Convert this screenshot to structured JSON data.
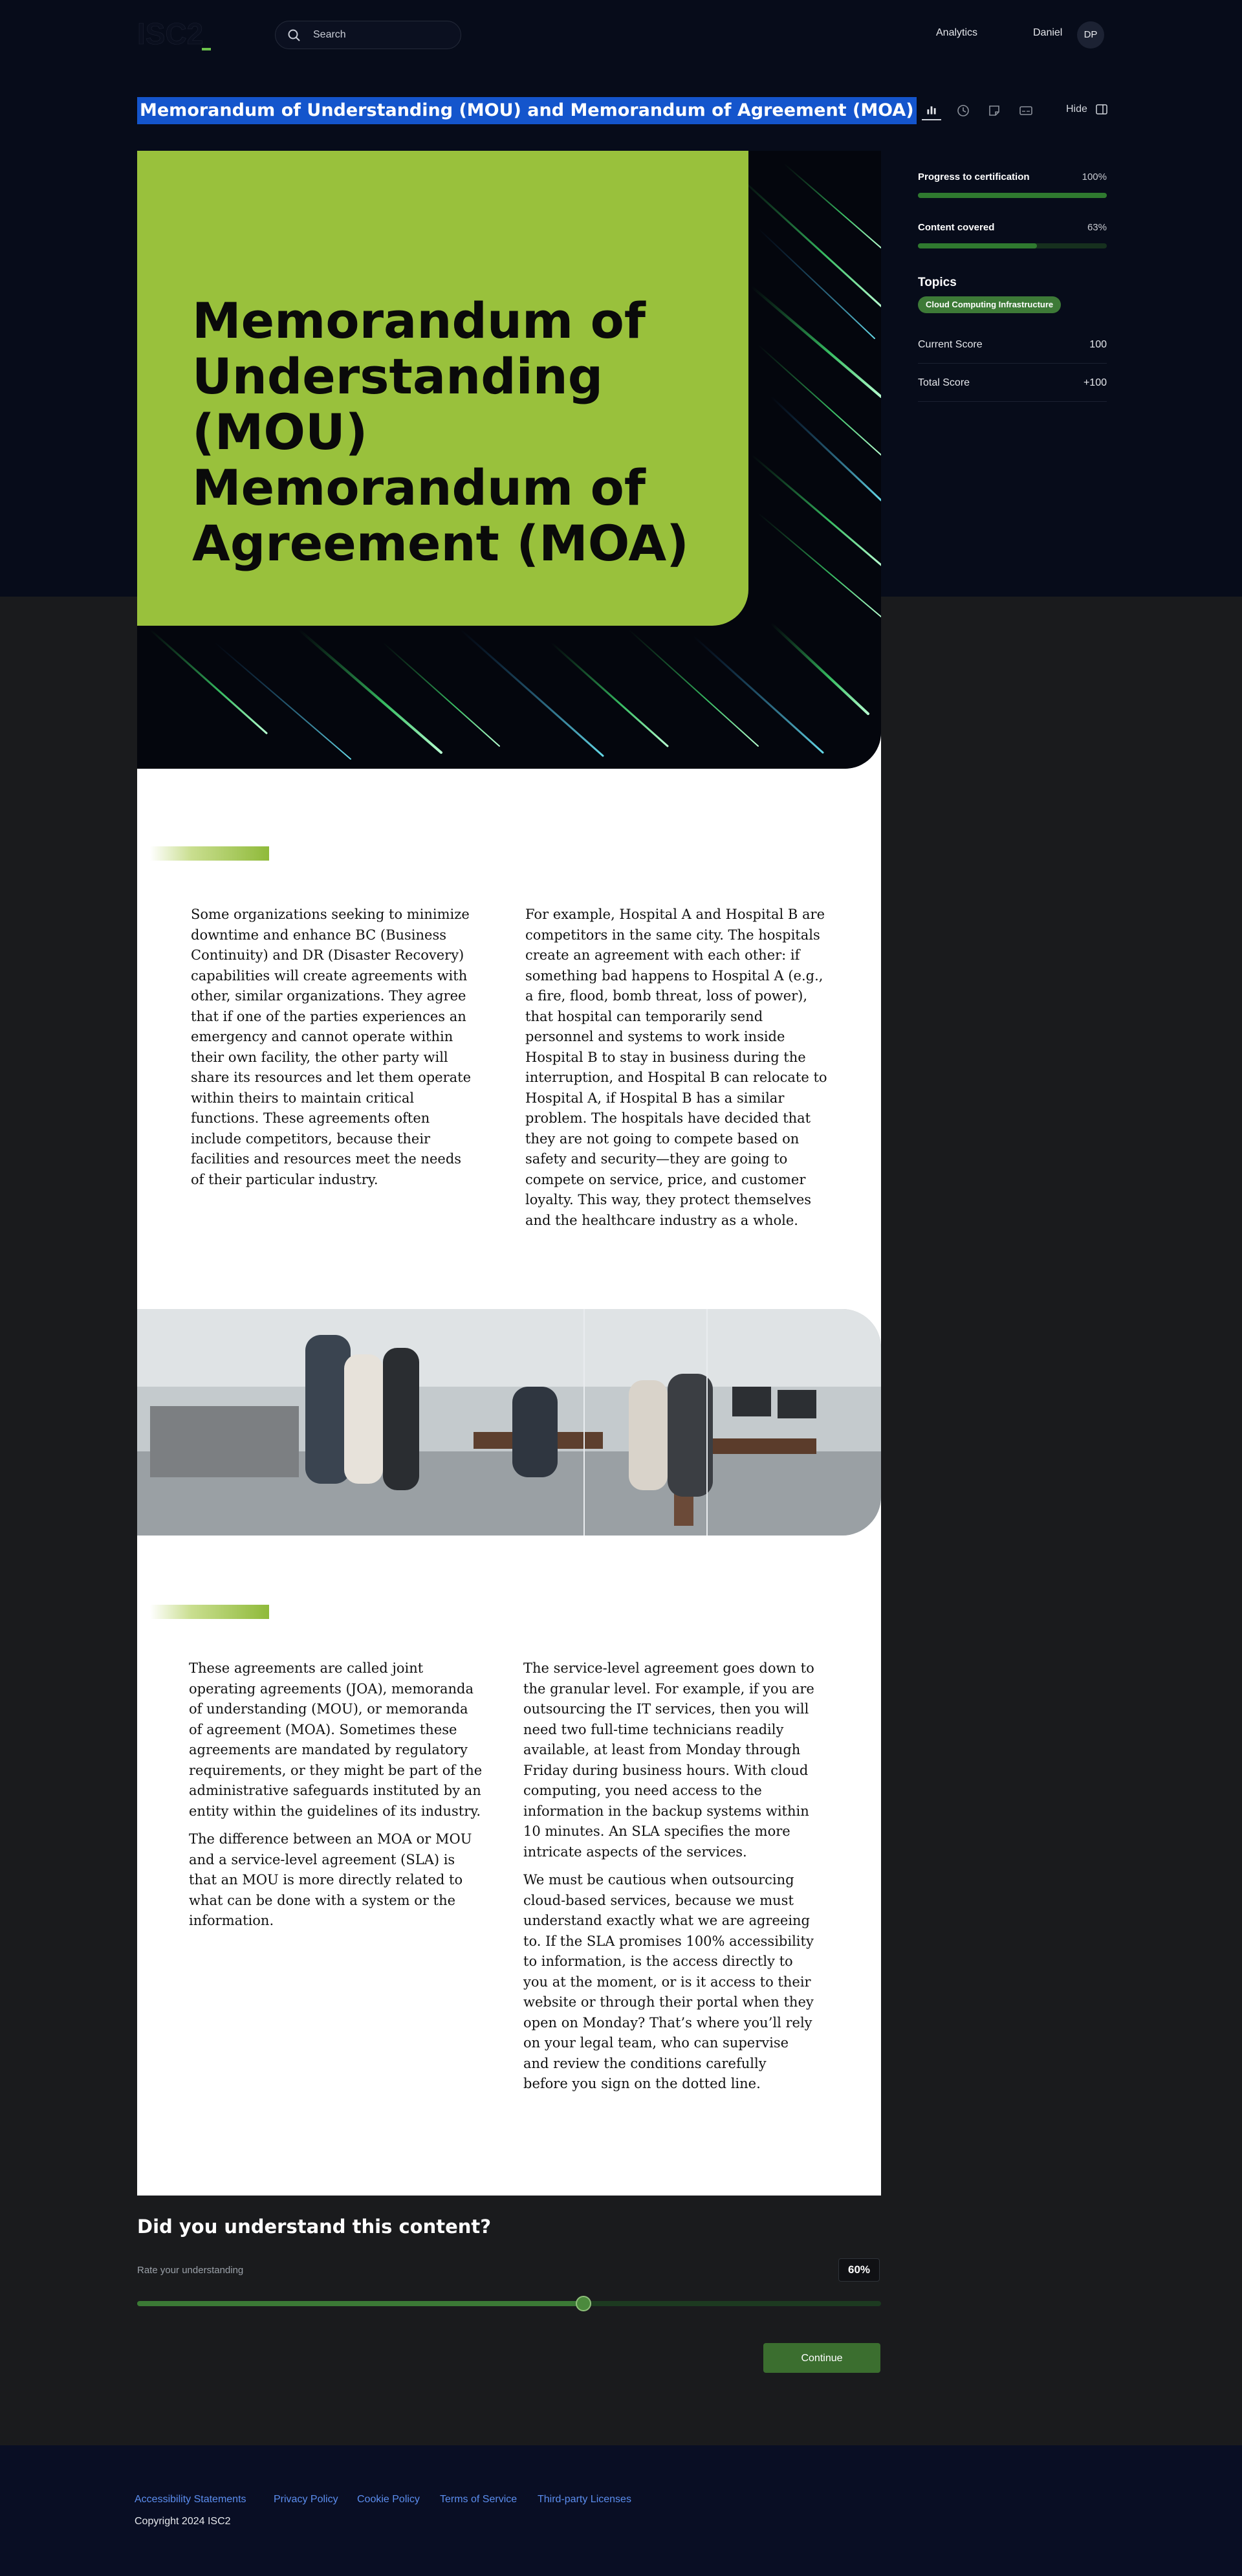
{
  "header": {
    "logo_text": "ISC2",
    "search_placeholder": "Search",
    "nav_analytics": "Analytics",
    "user_name": "Daniel",
    "avatar_initials": "DP"
  },
  "page": {
    "title": "Memorandum of Understanding (MOU) and Memorandum of Agreement (MOA)"
  },
  "toolbar": {
    "icons": [
      "stats-icon",
      "history-icon",
      "note-icon",
      "captions-icon"
    ],
    "hide_label": "Hide"
  },
  "progress": {
    "certification_label": "Progress to certification",
    "certification_value": "100%",
    "certification_fraction": 1.0,
    "content_label": "Content covered",
    "content_value": "63%",
    "content_fraction": 0.63
  },
  "topics": {
    "heading": "Topics",
    "items": [
      "Cloud Computing Infrastructure"
    ]
  },
  "scores": {
    "current_label": "Current Score",
    "current_value": "100",
    "total_label": "Total Score",
    "total_value": "+100"
  },
  "hero": {
    "title": "Memorandum of Understanding (MOU) Memorandum of Agreement (MOA)"
  },
  "section1": {
    "left": "Some organizations seeking to minimize downtime and enhance BC (Business Continuity) and DR (Disaster Recovery) capabilities will create agreements with other, similar organizations. They agree that if one of the parties experiences an emergency and cannot operate within their own facility, the other party will share its resources and let them operate within theirs to maintain critical functions. These agreements often include competitors, because their facilities and resources meet the needs of their particular industry.",
    "right": "For example, Hospital A and Hospital B are competitors in the same city. The hospitals create an agreement with each other: if something bad happens to Hospital A (e.g., a fire, flood, bomb threat, loss of power), that hospital can temporarily send personnel and systems to work inside Hospital B to stay in business during the interruption, and Hospital B can relocate to Hospital A, if Hospital B has a similar problem. The hospitals have decided that they are not going to compete based on safety and security—they are going to compete on service, price, and customer loyalty. This way, they protect themselves and the healthcare industry as a whole."
  },
  "section2": {
    "left_p1": "These agreements are called joint operating agreements (JOA), memoranda of understanding (MOU), or memoranda of agreement (MOA). Sometimes these agreements are mandated by regulatory requirements, or they might be part of the administrative safeguards instituted by an entity within the guidelines of its industry.",
    "left_p2": "The difference between an MOA or MOU and a service-level agreement (SLA) is that an MOU is more directly related to what can be done with a system or the information.",
    "right_p1": "The service-level agreement goes down to the granular level. For example, if you are outsourcing the IT services, then you will need two full-time technicians readily available, at least from Monday through Friday during business hours. With cloud computing, you need access to the information in the backup systems within 10 minutes. An SLA specifies the more intricate aspects of the services.",
    "right_p2": "We must be cautious when outsourcing cloud-based services, because we must understand exactly what we are agreeing to. If the SLA promises 100% accessibility to information, is the access directly to you at the moment, or is it access to their website or through their portal when they open on Monday? That’s where you’ll rely on your legal team, who can supervise and review the conditions carefully before you sign on the dotted line."
  },
  "understanding": {
    "heading": "Did you understand this content?",
    "subheading": "Rate your understanding",
    "value_label": "60%",
    "value_fraction": 0.6,
    "continue_label": "Continue"
  },
  "footer": {
    "links": [
      "Accessibility Statements",
      "Privacy Policy",
      "Cookie Policy",
      "Terms of Service",
      "Third-party Licenses"
    ],
    "copyright": "Copyright 2024 ISC2"
  },
  "colors": {
    "brand_green": "#99c13c",
    "progress_green": "#2f7a2f",
    "highlight_blue": "#1455cc",
    "link_blue": "#5b8dee"
  }
}
